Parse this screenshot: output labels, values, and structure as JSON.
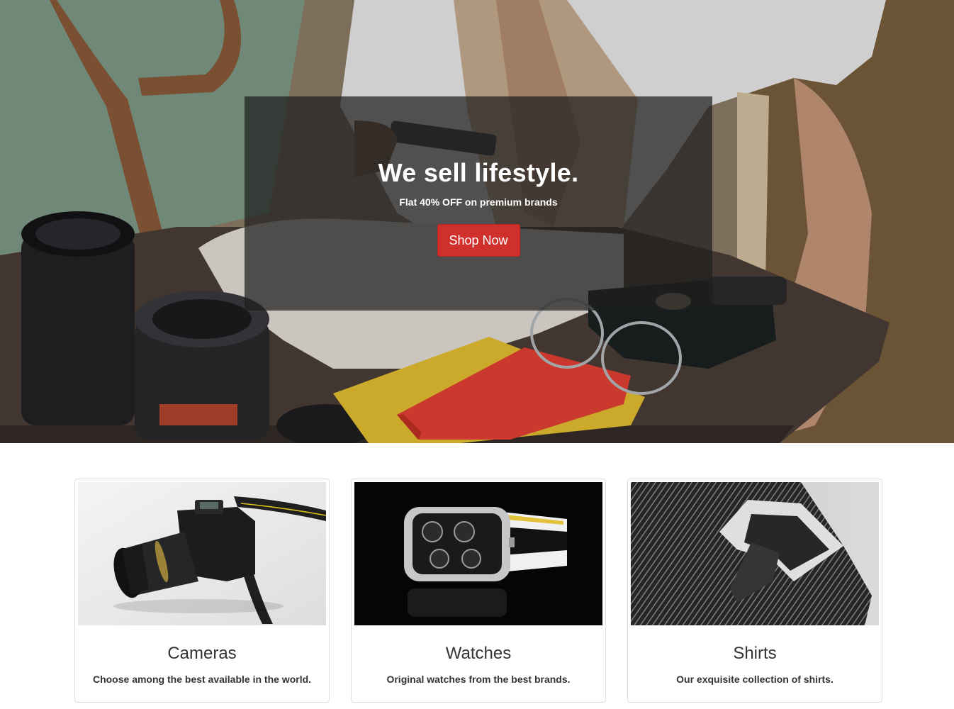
{
  "hero": {
    "title": "We sell lifestyle.",
    "subtitle": "Flat 40% OFF on premium brands",
    "cta_label": "Shop Now",
    "cta_color": "#d0302b"
  },
  "cards": [
    {
      "title": "Cameras",
      "description": "Choose among the best available in the world.",
      "image": "camera-photo"
    },
    {
      "title": "Watches",
      "description": "Original watches from the best brands.",
      "image": "watch-photo"
    },
    {
      "title": "Shirts",
      "description": "Our exquisite collection of shirts.",
      "image": "shirt-photo"
    }
  ]
}
